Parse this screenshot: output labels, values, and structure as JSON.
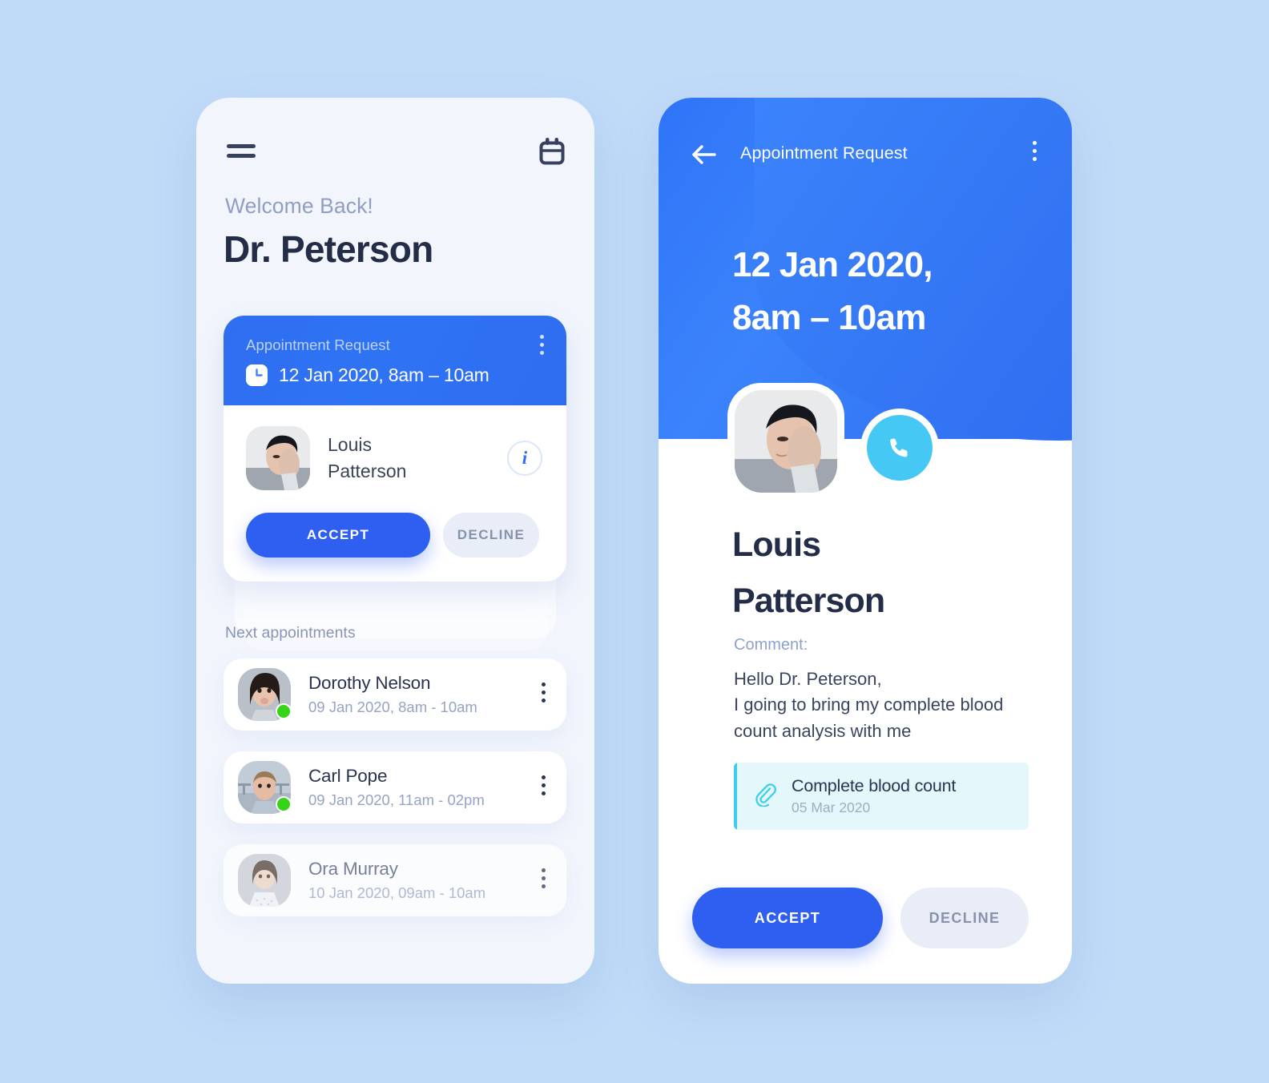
{
  "theme": {
    "page_background": "#c0dbf8",
    "accent_blue": "#2f5ff0",
    "header_blue": "#3b83fb",
    "cyan": "#45c8f4",
    "online_green": "#35d419",
    "dark_text": "#242d48",
    "muted_text": "#8f9ec4",
    "attach_bg": "#e4f8fb",
    "attach_bar": "#3ecdf0"
  },
  "left_screen": {
    "topbar": {
      "menu_icon": "hamburger-menu-icon",
      "calendar_icon": "calendar-icon"
    },
    "greeting": "Welcome Back!",
    "doctor_name": "Dr. Peterson",
    "request_card": {
      "label": "Appointment Request",
      "clock_icon": "clock-icon",
      "datetime": "12 Jan 2020, 8am – 10am",
      "more_icon": "kebab-menu-icon",
      "patient_name": "Louis\nPatterson",
      "info_icon": "info-icon",
      "accept_label": "ACCEPT",
      "decline_label": "DECLINE"
    },
    "next_section_label": "Next appointments",
    "appointments": [
      {
        "name": "Dorothy Nelson",
        "time": "09 Jan 2020, 8am - 10am",
        "online": true,
        "more_icon": "kebab-menu-icon"
      },
      {
        "name": "Carl Pope",
        "time": "09 Jan 2020, 11am - 02pm",
        "online": true,
        "more_icon": "kebab-menu-icon"
      },
      {
        "name": "Ora Murray",
        "time": "10 Jan 2020, 09am - 10am",
        "online": false,
        "more_icon": "kebab-menu-icon"
      }
    ]
  },
  "right_screen": {
    "topbar": {
      "back_icon": "back-arrow-icon",
      "title": "Appointment Request",
      "more_icon": "kebab-menu-icon"
    },
    "date_heading": "12 Jan 2020,\n8am – 10am",
    "call_icon": "phone-call-icon",
    "patient_name": "Louis\nPatterson",
    "comment_label": "Comment:",
    "comment_text": "Hello Dr. Peterson,\nI going to bring my complete blood\ncount analysis with me",
    "attachment": {
      "clip_icon": "paperclip-icon",
      "title": "Complete blood count",
      "date": "05 Mar 2020"
    },
    "accept_label": "ACCEPT",
    "decline_label": "DECLINE"
  }
}
